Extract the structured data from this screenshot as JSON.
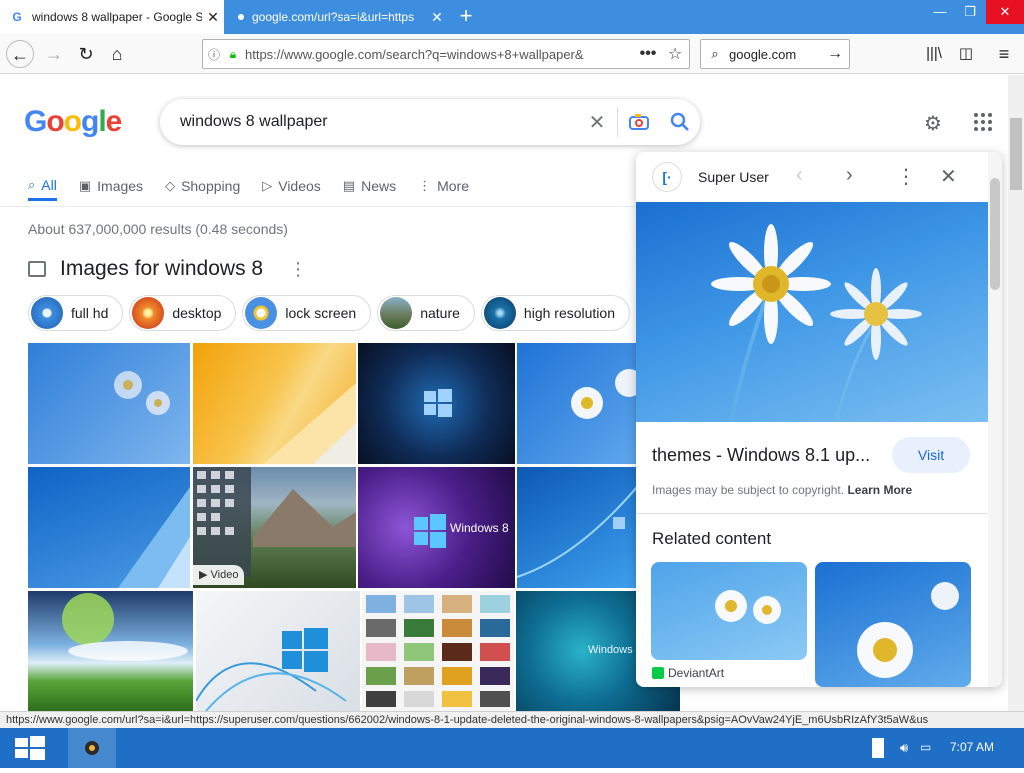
{
  "browser": {
    "tabs": [
      {
        "title": "windows 8 wallpaper - Google S",
        "active": true
      },
      {
        "title": "google.com/url?sa=i&url=https",
        "active": false
      }
    ],
    "url": "https://www.google.com/search?q=windows+8+wallpaper&",
    "search_engine": "google.com",
    "status_url": "https://www.google.com/url?sa=i&url=https://superuser.com/questions/662002/windows-8-1-update-deleted-the-original-windows-8-wallpapers&psig=AOvVaw24YjE_m6UsbRIzAfY3t5aW&us"
  },
  "google": {
    "logo": "Google",
    "query": "windows 8 wallpaper",
    "tabs": [
      {
        "label": "All",
        "icon": "search-icon"
      },
      {
        "label": "Images",
        "icon": "image-icon"
      },
      {
        "label": "Shopping",
        "icon": "tag-icon"
      },
      {
        "label": "Videos",
        "icon": "play-icon"
      },
      {
        "label": "News",
        "icon": "news-icon"
      },
      {
        "label": "More",
        "icon": "more-icon"
      }
    ],
    "stats": "About 637,000,000 results (0.48 seconds)",
    "images_heading": "Images for windows 8",
    "chips": [
      "full hd",
      "desktop",
      "lock screen",
      "nature",
      "high resolution"
    ],
    "video_badge": "Video",
    "tile_windows8_text": "Windows 8",
    "tile_windows_text": "Windows"
  },
  "panel": {
    "source": "Super User",
    "title": "themes - Windows 8.1 up...",
    "visit": "Visit",
    "copyright": "Images may be subject to copyright.",
    "learn_more": "Learn More",
    "related_heading": "Related content",
    "related_source": "DeviantArt"
  },
  "taskbar": {
    "time": "7:07 AM"
  },
  "colors": {
    "accent": "#1a73e8",
    "tabbar": "#3e8ee0",
    "taskbar": "#1e6fc5",
    "close_red": "#e81123"
  }
}
